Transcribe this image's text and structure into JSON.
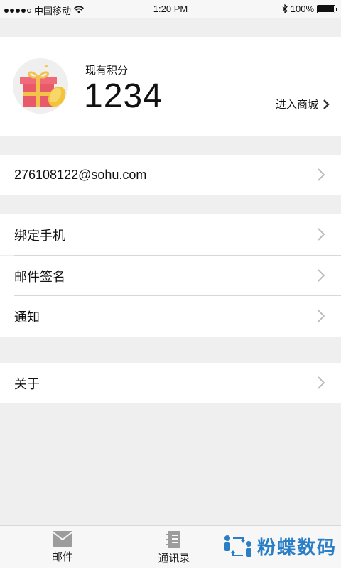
{
  "status_bar": {
    "carrier": "中国移动",
    "time": "1:20 PM",
    "battery": "100%"
  },
  "points": {
    "label": "现有积分",
    "value": "1234",
    "mall_link": "进入商城"
  },
  "account": {
    "email": "276108122@sohu.com"
  },
  "settings": [
    {
      "label": "绑定手机"
    },
    {
      "label": "邮件签名"
    },
    {
      "label": "通知"
    }
  ],
  "about": {
    "label": "关于"
  },
  "tab_bar": {
    "tabs": [
      {
        "label": "邮件",
        "icon": "mail-icon"
      },
      {
        "label": "通讯录",
        "icon": "contacts-icon"
      }
    ],
    "brand": "粉蝶数码"
  }
}
